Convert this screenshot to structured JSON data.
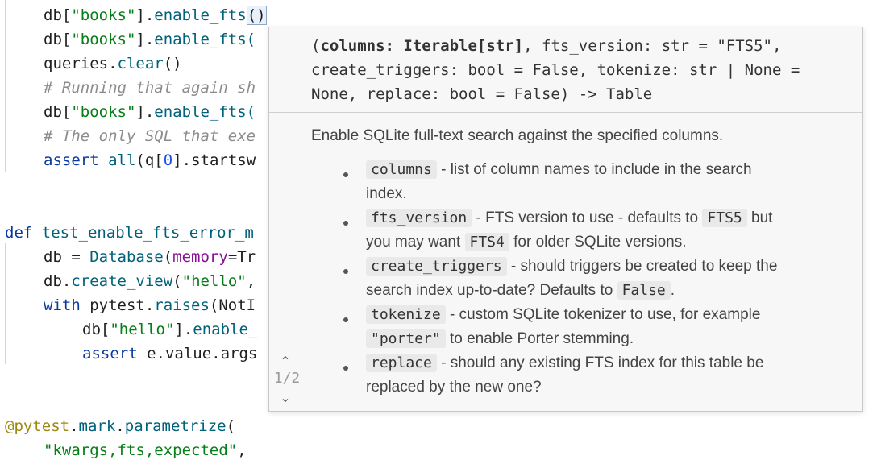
{
  "editor": {
    "line1": {
      "a": "db[",
      "b": "\"books\"",
      "c": "].",
      "d": "enable_fts",
      "e": "()"
    },
    "line2": {
      "a": "db[",
      "b": "\"books\"",
      "c": "].",
      "d": "enable_fts("
    },
    "line3": {
      "a": "queries.",
      "b": "clear",
      "c": "()"
    },
    "line4": "# Running that again sh",
    "line5": {
      "a": "db[",
      "b": "\"books\"",
      "c": "].",
      "d": "enable_fts("
    },
    "line6": "# The only SQL that exe",
    "line7": {
      "a": "assert ",
      "b": "all",
      "c": "(q[",
      "d": "0",
      "e": "].startsw"
    },
    "line8": {
      "a": "def ",
      "b": "test_enable_fts_error_m"
    },
    "line9": {
      "a": "db = ",
      "b": "Database",
      "c": "(",
      "d": "memory",
      "e": "=Tr"
    },
    "line10": {
      "a": "db.",
      "b": "create_view",
      "c": "(",
      "d": "\"hello\"",
      "e": ","
    },
    "line11": {
      "a": "with ",
      "b": "pytest.",
      "c": "raises",
      "d": "(NotI"
    },
    "line12": {
      "a": "db[",
      "b": "\"hello\"",
      "c": "].",
      "d": "enable_"
    },
    "line13": {
      "a": "assert ",
      "b": "e.value.args"
    },
    "line14": {
      "a": "@pytest",
      "b": ".",
      "c": "mark",
      "d": ".",
      "e": "parametrize",
      "f": "("
    },
    "line15": {
      "a": "\"kwargs,fts,expected\"",
      "b": ","
    }
  },
  "popup": {
    "signature": {
      "current_param": "columns: Iterable[str]",
      "line1_start": "(",
      "line1_end": ", fts_version: str = \"FTS5\",",
      "line2": "create_triggers: bool = False, tokenize: str | None =",
      "line3": "None, replace: bool = False) -> Table"
    },
    "nav": {
      "up": "⌃",
      "count": "1/2",
      "down": "⌄"
    },
    "doc": {
      "summary": "Enable SQLite full-text search against the specified columns.",
      "items": [
        {
          "code": "columns",
          "text1": " - list of column names to include in the search",
          "text2": "index."
        },
        {
          "code": "fts_version",
          "text1": " - FTS version to use - defaults to ",
          "code2": "FTS5",
          "text1b": " but",
          "text2a": "you may want ",
          "code3": "FTS4",
          "text2b": " for older SQLite versions."
        },
        {
          "code": "create_triggers",
          "text1": " - should triggers be created to keep the",
          "text2a": "search index up-to-date? Defaults to ",
          "code2": "False",
          "text2b": "."
        },
        {
          "code": "tokenize",
          "text1": " - custom SQLite tokenizer to use, for example",
          "code2": "\"porter\"",
          "text2b": " to enable Porter stemming."
        },
        {
          "code": "replace",
          "text1": " - should any existing FTS index for this table be",
          "text2": "replaced by the new one?"
        }
      ]
    }
  }
}
